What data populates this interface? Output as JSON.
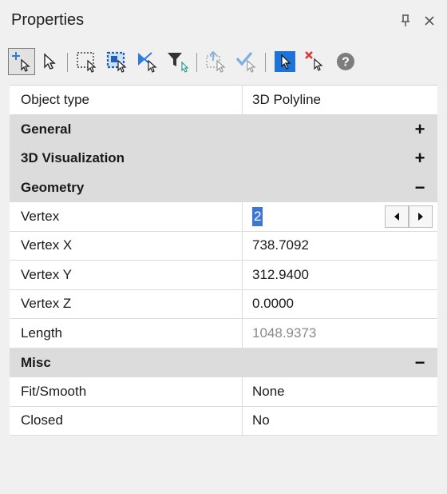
{
  "window": {
    "title": "Properties",
    "pin_icon": "pin-icon",
    "close_icon": "close-icon"
  },
  "toolbar": {
    "tools": [
      {
        "name": "add-to-selection-icon",
        "active": true
      },
      {
        "name": "select-objects-icon"
      },
      {
        "name": "select-window-icon"
      },
      {
        "name": "select-crossing-icon"
      },
      {
        "name": "invert-selection-icon"
      },
      {
        "name": "filter-selection-icon"
      },
      {
        "name": "select-similar-icon"
      },
      {
        "name": "accept-selection-icon"
      },
      {
        "name": "pickfirst-icon"
      },
      {
        "name": "deselect-all-icon"
      },
      {
        "name": "help-icon"
      }
    ]
  },
  "properties": {
    "object_type_label": "Object type",
    "object_type_value": "3D Polyline",
    "categories": {
      "general": {
        "label": "General",
        "toggle": "+"
      },
      "visualization": {
        "label": "3D Visualization",
        "toggle": "+"
      },
      "geometry": {
        "label": "Geometry",
        "toggle": "−"
      },
      "misc": {
        "label": "Misc",
        "toggle": "−"
      }
    },
    "geometry": {
      "vertex_label": "Vertex",
      "vertex_value": "2",
      "vertex_x_label": "Vertex X",
      "vertex_x_value": "738.7092",
      "vertex_y_label": "Vertex Y",
      "vertex_y_value": "312.9400",
      "vertex_z_label": "Vertex Z",
      "vertex_z_value": "0.0000",
      "length_label": "Length",
      "length_value": "1048.9373"
    },
    "misc": {
      "fit_smooth_label": "Fit/Smooth",
      "fit_smooth_value": "None",
      "closed_label": "Closed",
      "closed_value": "No"
    }
  },
  "colors": {
    "accent": "#3b78d6",
    "panel_bg": "#f0f0f0",
    "category_bg": "#dcdcdc",
    "delete_red": "#e03030"
  }
}
